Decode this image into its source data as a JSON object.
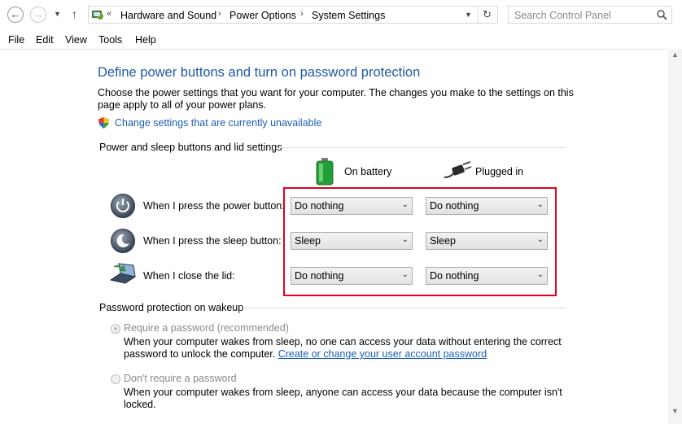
{
  "address": {
    "crumbs": [
      "Hardware and Sound",
      "Power Options",
      "System Settings"
    ],
    "search_placeholder": "Search Control Panel"
  },
  "menu": [
    "File",
    "Edit",
    "View",
    "Tools",
    "Help"
  ],
  "page": {
    "title": "Define power buttons and turn on password protection",
    "description_line1": "Choose the power settings that you want for your computer. The changes you make to the settings on this",
    "description_line2": "page apply to all of your power plans.",
    "change_link": "Change settings that are currently unavailable",
    "section1": "Power and sleep buttons and lid settings",
    "col_battery": "On battery",
    "col_plugged": "Plugged in",
    "rows": [
      {
        "label": "When I press the power button:",
        "battery": "Do nothing",
        "plugged": "Do nothing"
      },
      {
        "label": "When I press the sleep button:",
        "battery": "Sleep",
        "plugged": "Sleep"
      },
      {
        "label": "When I close the lid:",
        "battery": "Do nothing",
        "plugged": "Do nothing"
      }
    ],
    "section2": "Password protection on wakeup",
    "opt1_label": "Require a password (recommended)",
    "opt1_desc1": "When your computer wakes from sleep, no one can access your data without entering the correct",
    "opt1_desc2_prefix": "password to unlock the computer.",
    "opt1_link": "Create or change your user account password",
    "opt2_label": "Don't require a password",
    "opt2_desc1": "When your computer wakes from sleep, anyone can access your data because the computer isn't",
    "opt2_desc2": "locked."
  }
}
